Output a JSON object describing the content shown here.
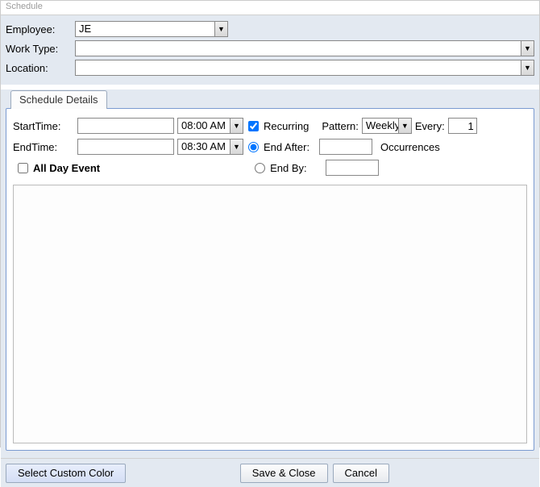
{
  "window": {
    "title": "Schedule"
  },
  "header": {
    "employee_label": "Employee:",
    "employee_value": "JE",
    "worktype_label": "Work Type:",
    "worktype_value": "",
    "location_label": "Location:",
    "location_value": ""
  },
  "tab": {
    "label": "Schedule Details"
  },
  "details": {
    "start_label": "StartTime:",
    "start_date": "",
    "start_time": "08:00 AM",
    "end_label": "EndTime:",
    "end_date": "",
    "end_time": "08:30 AM",
    "allday_label": "All Day Event",
    "recurring_label": "Recurring",
    "recurring_checked": true,
    "pattern_label": "Pattern:",
    "pattern_value": "Weekly",
    "every_label": "Every:",
    "every_value": "1",
    "endafter_label": "End After:",
    "endafter_value": "",
    "occurrences_label": "Occurrences",
    "endby_label": "End By:",
    "endby_value": ""
  },
  "footer": {
    "color_button": "Select Custom Color",
    "save_button": "Save & Close",
    "cancel_button": "Cancel"
  }
}
